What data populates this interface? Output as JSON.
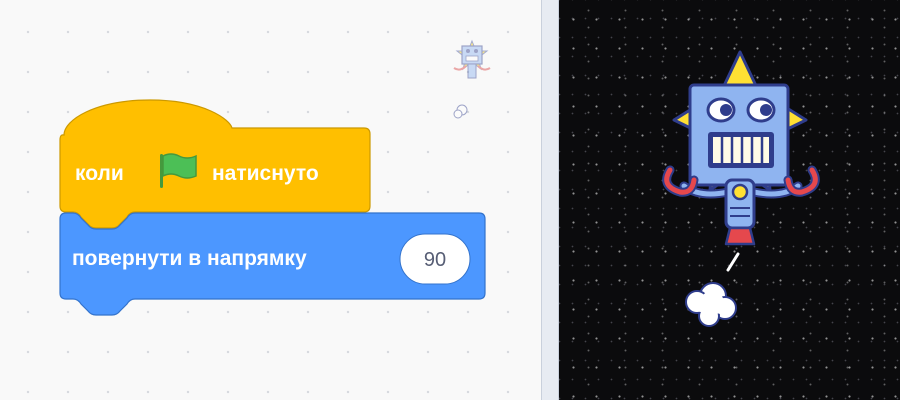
{
  "workspace": {
    "hat_block": {
      "label_before": "коли",
      "label_after": "натиснуто",
      "color": "#ffbf00",
      "icon": "green-flag-icon"
    },
    "motion_block": {
      "label": "повернути в напрямку",
      "direction_value": "90",
      "color": "#4c97ff"
    }
  },
  "sprite_thumbnail": {
    "icon": "robot-sprite-icon"
  },
  "stage": {
    "background": "space",
    "sprite": "robot-sprite-icon"
  }
}
